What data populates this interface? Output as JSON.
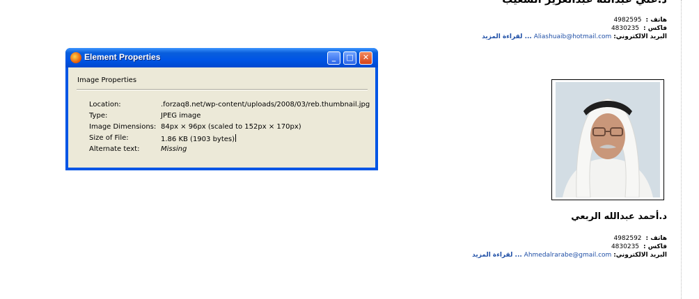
{
  "window": {
    "title": "Element Properties",
    "section": "Image Properties",
    "controls": {
      "minimize": "_",
      "maximize": "□",
      "close": "✕"
    },
    "properties": [
      {
        "label": "Location:",
        "value": ".forzaq8.net/wp-content/uploads/2008/03/reb.thumbnail.jpg"
      },
      {
        "label": "Type:",
        "value": "JPEG image"
      },
      {
        "label": "Image Dimensions:",
        "value": "84px × 96px (scaled to 152px × 170px)"
      },
      {
        "label": "Size of File:",
        "value": "1.86 KB (1903 bytes)"
      },
      {
        "label": "Alternate text:",
        "value": "Missing"
      }
    ]
  },
  "page": {
    "top_name": "د.علي عبدالله عبدالعزيز الشعيب",
    "contact1": {
      "phone_label": "هاتف :",
      "phone": "4982595",
      "fax_label": "فاكس :",
      "fax": "4830235",
      "email_label": "البريد الالكتروني:",
      "email": "Aliashuaib@hotmail.com",
      "more": "... لقراءة المزيد"
    },
    "person2_name": "د.أحمد عبدالله الربعي",
    "contact2": {
      "phone_label": "هاتف :",
      "phone": "4982592",
      "fax_label": "فاكس :",
      "fax": "4830235",
      "email_label": "البريد الالكتروني:",
      "email": "Ahmedalrarabe@gmail.com",
      "more": "... لقراءة المزيد"
    }
  }
}
